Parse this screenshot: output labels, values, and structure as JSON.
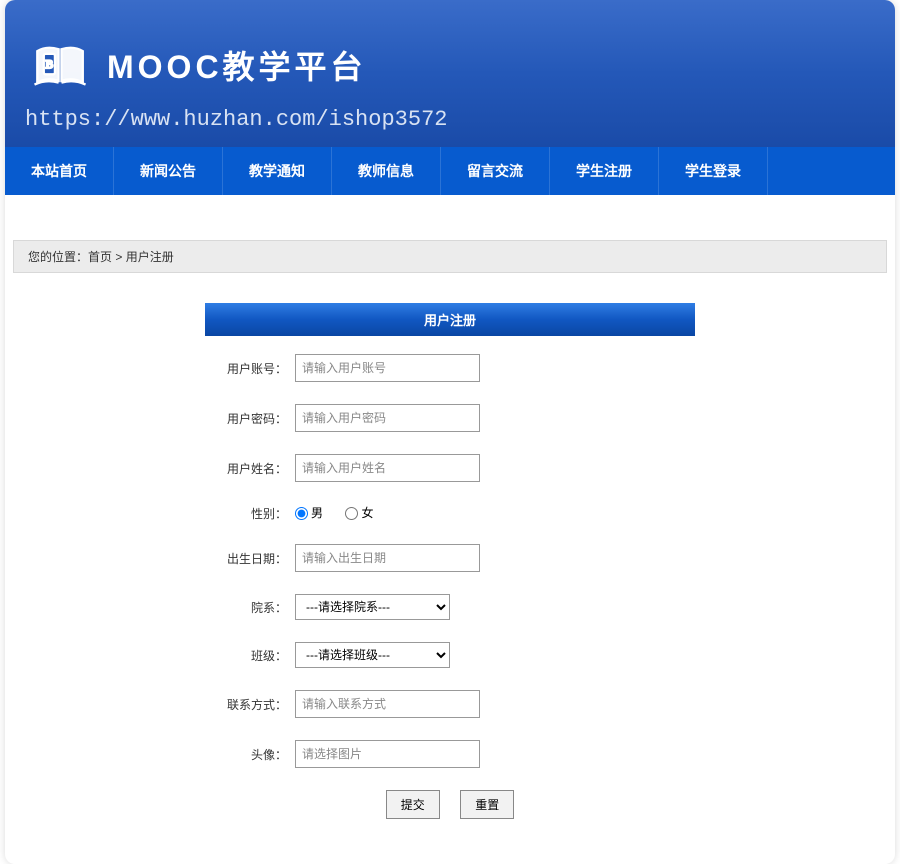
{
  "header": {
    "title": "MOOC教学平台",
    "url": "https://www.huzhan.com/ishop3572"
  },
  "nav": [
    "本站首页",
    "新闻公告",
    "教学通知",
    "教师信息",
    "留言交流",
    "学生注册",
    "学生登录"
  ],
  "breadcrumb": {
    "prefix": "您的位置：",
    "home": "首页",
    "sep": " > ",
    "current": "用户注册"
  },
  "form": {
    "title": "用户注册",
    "username": {
      "label": "用户账号：",
      "placeholder": "请输入用户账号"
    },
    "password": {
      "label": "用户密码：",
      "placeholder": "请输入用户密码"
    },
    "realname": {
      "label": "用户姓名：",
      "placeholder": "请输入用户姓名"
    },
    "gender": {
      "label": "性别：",
      "male": "男",
      "female": "女"
    },
    "birth": {
      "label": "出生日期：",
      "placeholder": "请输入出生日期"
    },
    "dept": {
      "label": "院系：",
      "placeholder": "---请选择院系---"
    },
    "class": {
      "label": "班级：",
      "placeholder": "---请选择班级---"
    },
    "contact": {
      "label": "联系方式：",
      "placeholder": "请输入联系方式"
    },
    "avatar": {
      "label": "头像：",
      "placeholder": "请选择图片"
    },
    "submit": "提交",
    "reset": "重置"
  }
}
